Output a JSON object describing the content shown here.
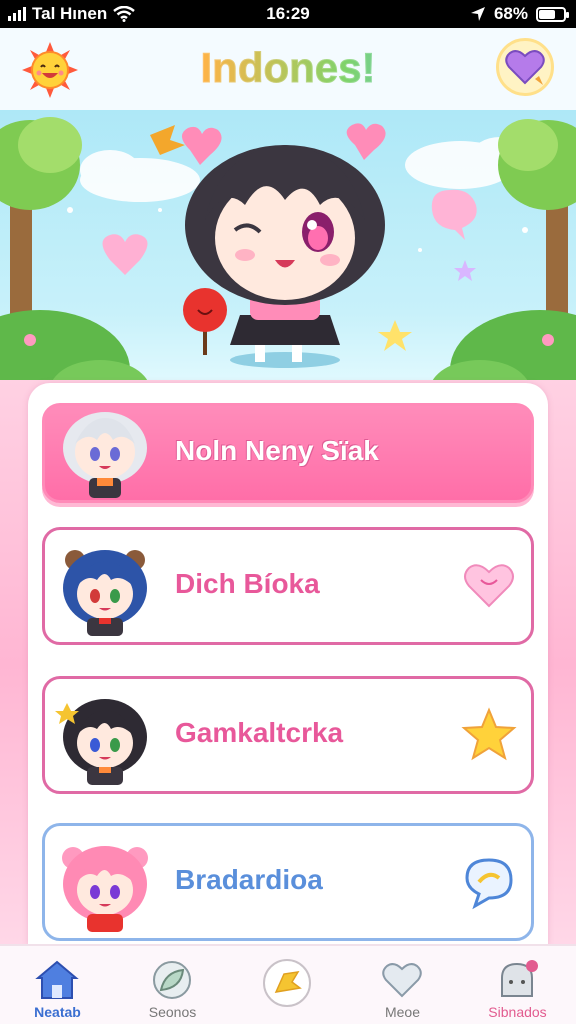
{
  "status_bar": {
    "carrier": "Tal Hınen",
    "time": "16:29",
    "battery": "68%",
    "battery_level": 0.68
  },
  "header": {
    "title": "Indones!",
    "sun_icon": "sun-face-icon",
    "chat_icon": "heart-chat-icon"
  },
  "list": {
    "items": [
      {
        "label": "Noln Neny Sïak",
        "color": "#ffffff",
        "state": "selected",
        "icon": "none"
      },
      {
        "label": "Dich Bíoka",
        "color": "#e8589a",
        "state": "normal",
        "icon": "heart-icon"
      },
      {
        "label": "Gamkaltcrka",
        "color": "#e8589a",
        "state": "normal",
        "icon": "star-icon"
      },
      {
        "label": "Bradardioa",
        "color": "#5a8fdb",
        "state": "normal",
        "icon": "speech-bubble-icon"
      }
    ]
  },
  "nav": {
    "items": [
      {
        "label": "Neatab",
        "icon": "home-icon",
        "color": "#3b6fd1"
      },
      {
        "label": "Seonos",
        "icon": "leaf-icon",
        "color": "#777777"
      },
      {
        "label": "",
        "icon": "center-star-icon",
        "color": "#f5c431"
      },
      {
        "label": "Meoe",
        "icon": "heart-outline-icon",
        "color": "#777777"
      },
      {
        "label": "Sibnados",
        "icon": "notification-icon",
        "color": "#e25b8f"
      }
    ]
  },
  "colors": {
    "accent_pink": "#ff6ea8",
    "border_pink": "#e06aa5",
    "blue": "#5a8fdb"
  }
}
